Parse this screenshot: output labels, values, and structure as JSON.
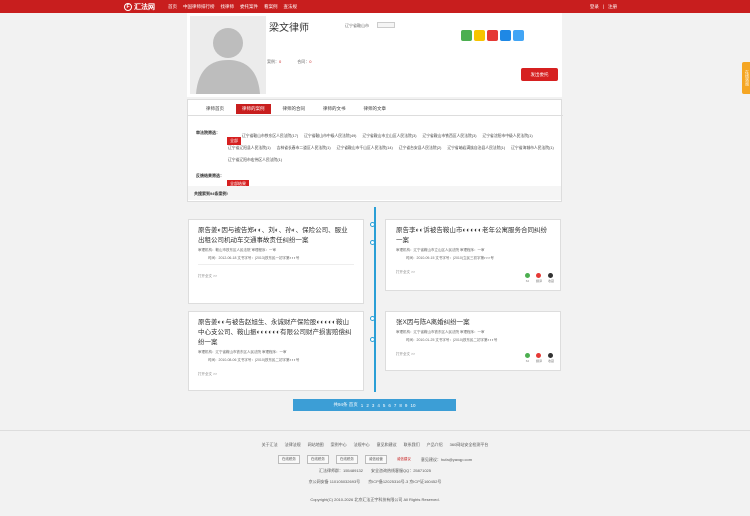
{
  "brand": {
    "logo_text": "汇法网",
    "logo_mark": "F"
  },
  "nav": [
    "首页",
    "中国律师排行榜",
    "找律师",
    "委托案件",
    "看案例",
    "查法规"
  ],
  "auth": {
    "login": "登录",
    "register": "注册"
  },
  "profile": {
    "name": "梁文律师",
    "region": "辽宁省鞍山市",
    "stats": [
      {
        "label": "案例：",
        "value": "0"
      },
      {
        "label": "合同：",
        "value": "0"
      }
    ],
    "consult_button": "发出委托"
  },
  "side_tab": "在线咨询",
  "tabs": [
    "律师首页",
    "律师的案例",
    "律师的合同",
    "律师的文书",
    "律师的文章"
  ],
  "filter": {
    "court_label": "审法院筛选：",
    "all_label": "全部",
    "courts": [
      "辽宁省鞍山市铁东区人民法院(17)",
      "辽宁省鞍山市中级人民法院(49)",
      "辽宁省鞍山市立山区人民法院(3)",
      "辽宁省鞍山市铁西区人民法院(3)",
      "辽宁省沈阳市中级人民法院(1)",
      "辽宁省辽阳县人民法院(1)",
      "吉林省长春市二道区人民法院(1)",
      "辽宁省鞍山市千山区人民法院(14)",
      "辽宁省台安县人民法院(2)",
      "辽宁省岫岩满族自治县人民法院(1)",
      "辽宁省海城市人民法院(1)",
      "辽宁省辽阳市宏伟区人民法院(1)"
    ],
    "verdict_label": "反馈结果筛选：",
    "verdict_all": "全部结果",
    "total": "共搜索到94条案例!"
  },
  "cases": [
    {
      "title": "原告姜◐因与被告郑◐◐、刘◐、孙◐、保险公司、服业出租公司机动车交通事故责任纠纷一案",
      "court": "审理机构：鞍山市铁东区人民法院 审理程序：一审",
      "meta": "时间：2012-06-18 文书字号：(2013)铁东民一初字第◐◐◐号",
      "open": "打开全文 >>"
    },
    {
      "title": "原告李◐◐诉被告鞍山市◐◐◐◐◐老年公寓服务合同纠纷一案",
      "court": "审理机构：辽宁省鞍山市立山区人民法院 审理程序：一审",
      "meta": "时间：2010-09-15 文书字号：(2010)立民三初字第◐◐◐号",
      "open": "打开全文 >>",
      "icons": [
        "62",
        "翻译",
        "收藏"
      ]
    },
    {
      "title": "原告姜◐◐与被告赵旭生、永诚财产保险股◐◐◐◐◐鞍山中心支公司、鞍山振◐◐◐◐◐◐有限公司财产损害赔偿纠纷一案",
      "court": "审理机构：辽宁省鞍山市铁东区人民法院 审理程序：一审",
      "meta": "时间：2010-08-06 文书字号：(2010)铁东民二初字第◐◐◐号",
      "open": "打开全文 >>"
    },
    {
      "title": "张X因与陈A离婚纠纷一案",
      "court": "审理机构：辽宁省鞍山市铁东区人民法院 审理程序：一审",
      "meta": "时间：2010-01-25 文书字号：(2010)铁东民二初字第◐◐◐号",
      "open": "打开全文 >>",
      "icons": [
        "62",
        "翻译",
        "收藏"
      ]
    }
  ],
  "pager": {
    "summary": "共94条 首页",
    "pages": [
      "1",
      "2",
      "3",
      "4",
      "5",
      "6",
      "7",
      "8",
      "9",
      "10"
    ]
  },
  "footer": {
    "links": [
      "关于汇法",
      "法律法规",
      "网站地图",
      "案例中心",
      "法规中心",
      "意见和建议",
      "联系我们",
      "产品介绍",
      "360网站安全检测平台"
    ],
    "badges": [
      "在线税务",
      "在线税务",
      "在线税务",
      "诚信经营",
      "诚信建议"
    ],
    "feedback": "意见建议：hufa@yaxqp.com",
    "line1": "汇法律师群：155489132　　安全咨询热线客服QQ：25871025",
    "line2": "京公网安备 110105032693号　　京ICP备12025316号-3 京ICP证160452号",
    "copyright": "Copyright(C) 2010-2026 北京汇法正宇科技有限公司 All Rights Reserved."
  },
  "colors": {
    "brand_red": "#c81e1e",
    "accent_blue": "#2a9fd6",
    "side_tab": "#f5a623"
  }
}
